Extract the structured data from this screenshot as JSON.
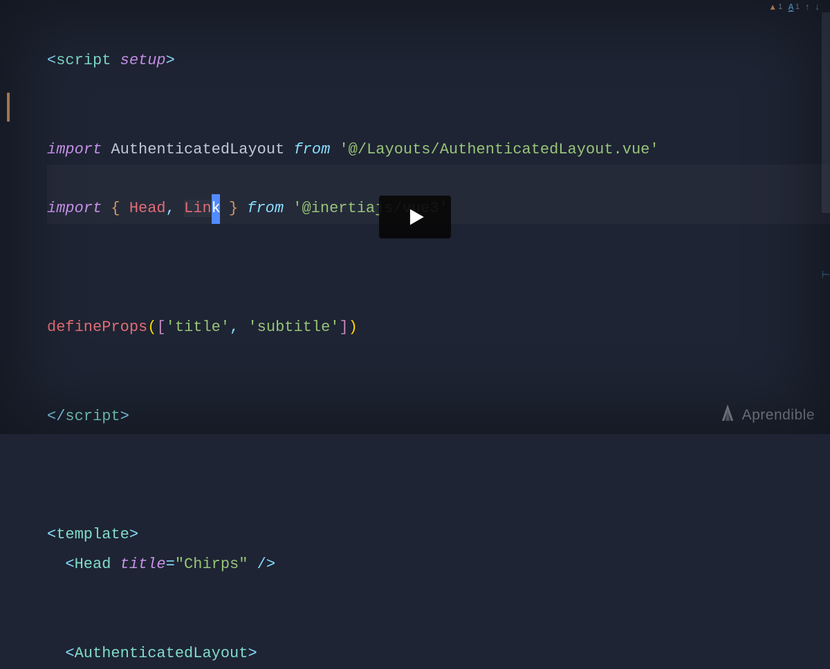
{
  "indicators": {
    "warn_count": "1",
    "hint_count": "1"
  },
  "code": {
    "line1": {
      "tag": "script",
      "attr": "setup"
    },
    "line2": {
      "kw": "import",
      "ident": "AuthenticatedLayout",
      "from": "from",
      "str": "'@/Layouts/AuthenticatedLayout.vue'"
    },
    "line3": {
      "kw": "import",
      "head": "Head",
      "link_pre": "Lin",
      "link_k": "k",
      "from": "from",
      "str": "'@inertiajs/vue3'"
    },
    "line4": {
      "func": "defineProps",
      "arg1": "'title'",
      "arg2": "'subtitle'"
    },
    "line5": {
      "tag": "script"
    },
    "line6": {
      "tag": "template"
    },
    "line7": {
      "tag": "Head",
      "attr": "title",
      "val": "\"Chirps\""
    },
    "line8": {
      "tag": "AuthenticatedLayout"
    }
  },
  "watermark": {
    "text": "Aprendible"
  }
}
